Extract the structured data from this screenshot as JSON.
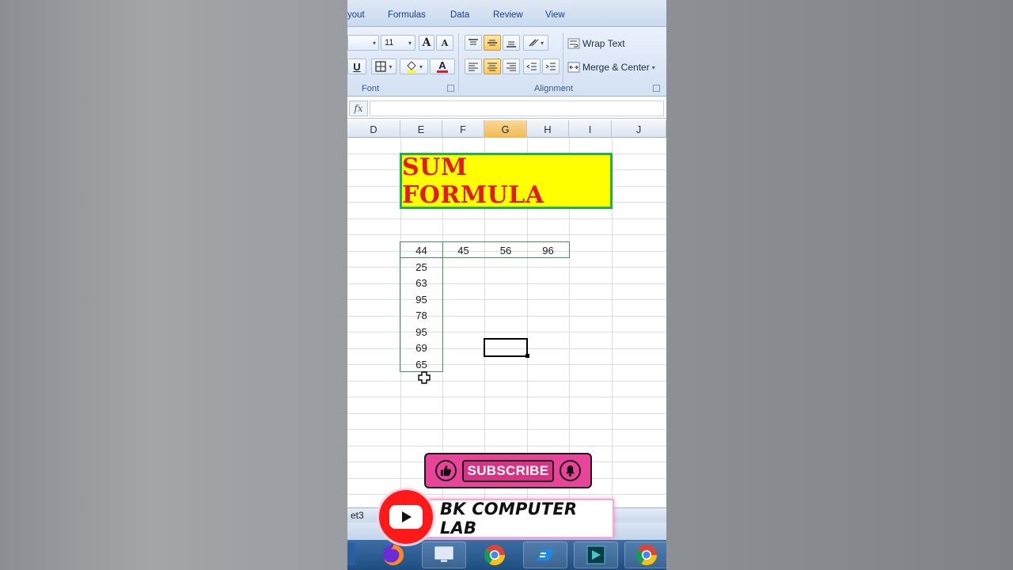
{
  "ribbon": {
    "tabs": [
      "yout",
      "Formulas",
      "Data",
      "Review",
      "View"
    ],
    "font_size": "11",
    "grow_font": "A",
    "shrink_font": "A",
    "font_color_letter": "A",
    "underline_letter": "U",
    "wrap_text": "Wrap Text",
    "merge_center": "Merge & Center",
    "group_font": "Font",
    "group_alignment": "Alignment"
  },
  "formula_bar": {
    "fx_label": "fx",
    "value": ""
  },
  "columns": [
    "D",
    "E",
    "F",
    "G",
    "H",
    "I",
    "J"
  ],
  "selected_column": "G",
  "sheet": {
    "title": "SUM FORMULA",
    "row_values": [
      "44",
      "45",
      "56",
      "96"
    ],
    "column_values": [
      "25",
      "63",
      "95",
      "78",
      "95",
      "69",
      "65"
    ]
  },
  "sheet_tab": "et3",
  "overlay": {
    "subscribe_label": "SUBSCRIBE",
    "channel_name": "BK COMPUTER LAB"
  },
  "colors": {
    "title_fill": "#ffff00",
    "title_text": "#e01b24",
    "title_border": "#1db34b",
    "subscribe_pink": "#e8449a",
    "youtube_red": "#ff1a1a"
  },
  "taskbar": {
    "icons": [
      "firefox-icon",
      "monitor-icon",
      "chrome-icon",
      "cp-icon",
      "media-icon",
      "chrome-icon"
    ]
  }
}
